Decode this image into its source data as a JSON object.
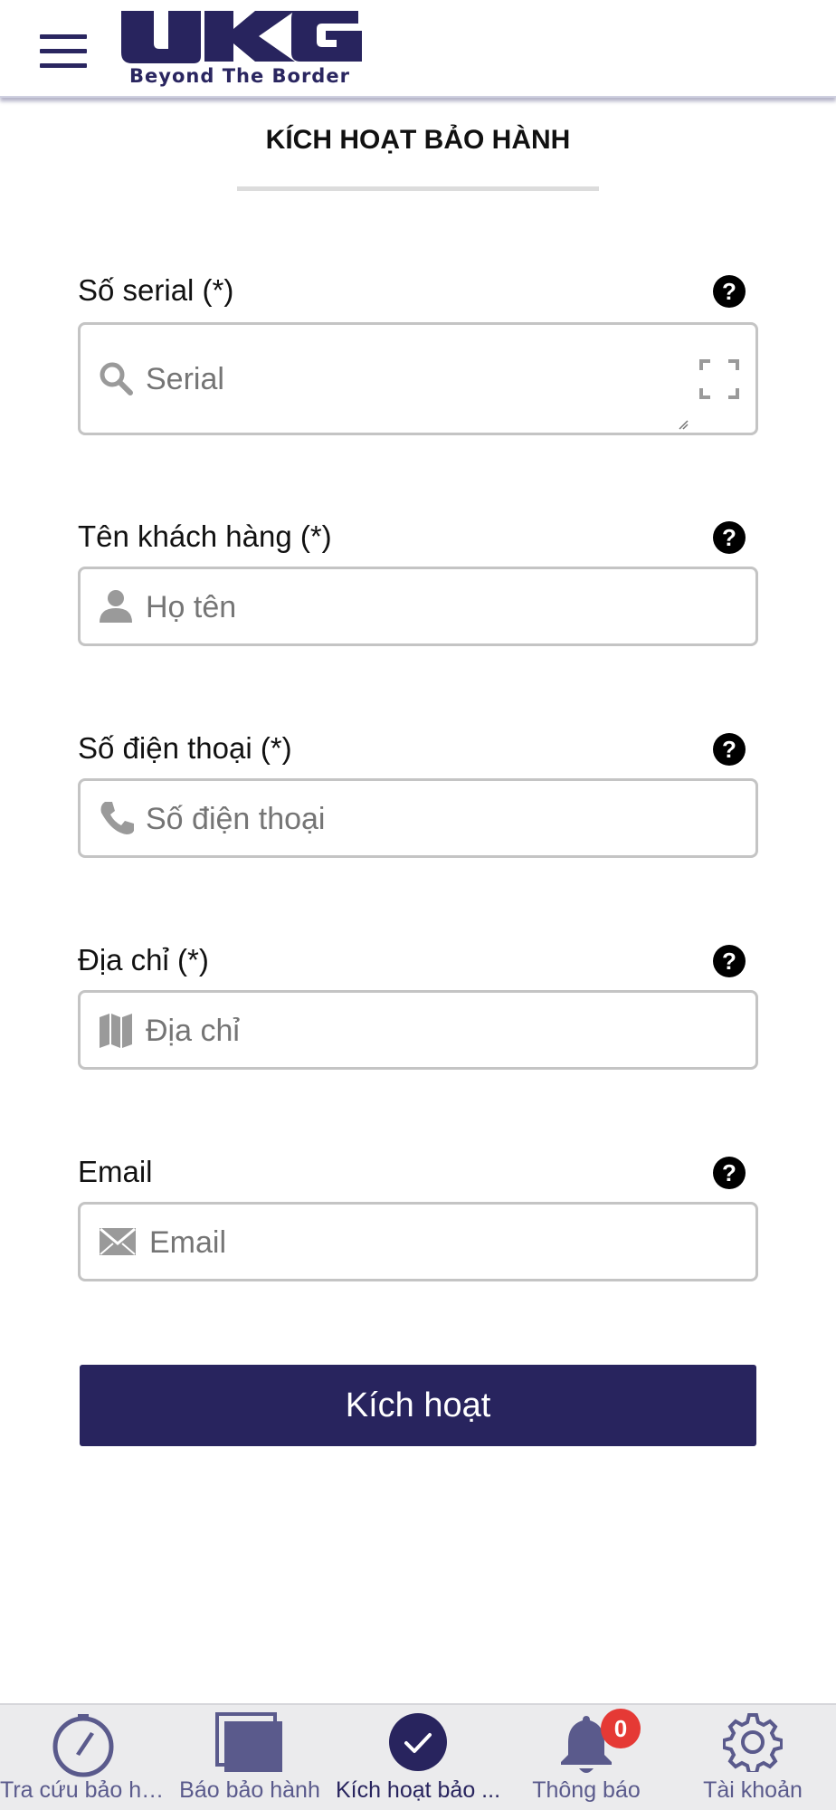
{
  "header": {
    "logo_text": "UKG",
    "tagline": "Beyond The Border"
  },
  "page": {
    "title": "KÍCH HOẠT BẢO HÀNH"
  },
  "form": {
    "serial": {
      "label": "Số serial (*)",
      "placeholder": "Serial",
      "icon": "search-icon"
    },
    "customer_name": {
      "label": "Tên khách hàng (*)",
      "placeholder": "Họ tên",
      "icon": "user-icon"
    },
    "phone": {
      "label": "Số điện thoại (*)",
      "placeholder": "Số điện thoại",
      "icon": "phone-icon"
    },
    "address": {
      "label": "Địa chỉ (*)",
      "placeholder": "Địa chỉ",
      "icon": "map-icon"
    },
    "email": {
      "label": "Email",
      "placeholder": "Email",
      "icon": "envelope-icon"
    },
    "help_symbol": "?",
    "submit_label": "Kích hoạt"
  },
  "bottom_nav": {
    "items": [
      {
        "label": "Tra cứu bảo hà...",
        "icon": "compass-icon"
      },
      {
        "label": "Báo bảo hành",
        "icon": "layers-icon"
      },
      {
        "label": "Kích hoạt bảo ...",
        "icon": "check-circle-icon",
        "active": true
      },
      {
        "label": "Thông báo",
        "icon": "bell-icon",
        "badge": "0"
      },
      {
        "label": "Tài khoản",
        "icon": "gear-icon"
      }
    ]
  },
  "colors": {
    "brand": "#28245e",
    "nav_inactive": "#5a5a8c",
    "badge": "#e53935",
    "input_border": "#c4c4c4"
  }
}
